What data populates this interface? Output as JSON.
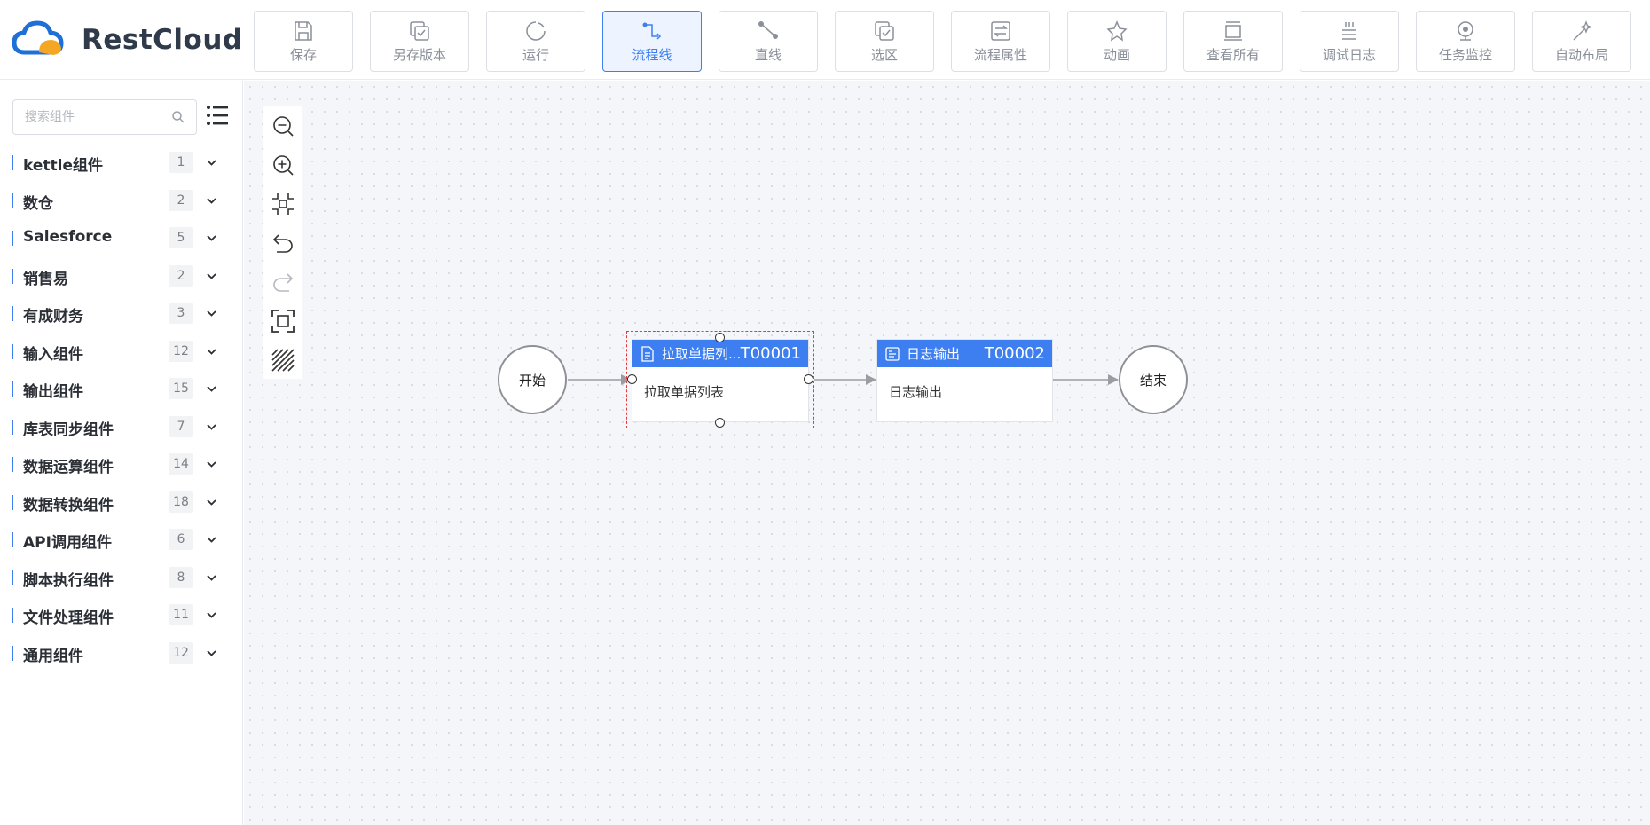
{
  "app": {
    "brand": "RestCloud",
    "accent": "#3d7ff0",
    "logo_colors": [
      "#1f6fd8",
      "#f5a623"
    ]
  },
  "toolbar": {
    "buttons": [
      {
        "label": "保存",
        "icon": "save-icon",
        "active": false
      },
      {
        "label": "另存版本",
        "icon": "save-version-icon",
        "active": false
      },
      {
        "label": "运行",
        "icon": "run-icon",
        "active": false
      },
      {
        "label": "流程线",
        "icon": "flow-line-icon",
        "active": true
      },
      {
        "label": "直线",
        "icon": "straight-line-icon",
        "active": false
      },
      {
        "label": "选区",
        "icon": "selection-icon",
        "active": false
      },
      {
        "label": "流程属性",
        "icon": "flow-properties-icon",
        "active": false
      },
      {
        "label": "动画",
        "icon": "animation-icon",
        "active": false
      },
      {
        "label": "查看所有",
        "icon": "view-all-icon",
        "active": false
      },
      {
        "label": "调试日志",
        "icon": "debug-log-icon",
        "active": false
      },
      {
        "label": "任务监控",
        "icon": "task-monitor-icon",
        "active": false
      },
      {
        "label": "自动布局",
        "icon": "auto-layout-icon",
        "active": false
      }
    ]
  },
  "sidebar": {
    "search_placeholder": "搜索组件",
    "categories": [
      {
        "label": "kettle组件",
        "count": "1"
      },
      {
        "label": "数仓",
        "count": "2"
      },
      {
        "label": "Salesforce",
        "count": "5"
      },
      {
        "label": "销售易",
        "count": "2"
      },
      {
        "label": "有成财务",
        "count": "3"
      },
      {
        "label": "输入组件",
        "count": "12"
      },
      {
        "label": "输出组件",
        "count": "15"
      },
      {
        "label": "库表同步组件",
        "count": "7"
      },
      {
        "label": "数据运算组件",
        "count": "14"
      },
      {
        "label": "数据转换组件",
        "count": "18"
      },
      {
        "label": "API调用组件",
        "count": "6"
      },
      {
        "label": "脚本执行组件",
        "count": "8"
      },
      {
        "label": "文件处理组件",
        "count": "11"
      },
      {
        "label": "通用组件",
        "count": "12"
      }
    ]
  },
  "canvas": {
    "zoom_tools": [
      "zoom-out-icon",
      "zoom-in-icon",
      "fit-view-icon",
      "undo-icon",
      "redo-icon",
      "actual-size-icon",
      "grid-toggle-icon"
    ],
    "start_node": {
      "label": "开始"
    },
    "end_node": {
      "label": "结束"
    },
    "task1": {
      "name": "拉取单据列...",
      "id": "T00001",
      "body": "拉取单据列表",
      "selected": true
    },
    "task2": {
      "name": "日志输出",
      "id": "T00002",
      "body": "日志输出",
      "selected": false
    }
  }
}
